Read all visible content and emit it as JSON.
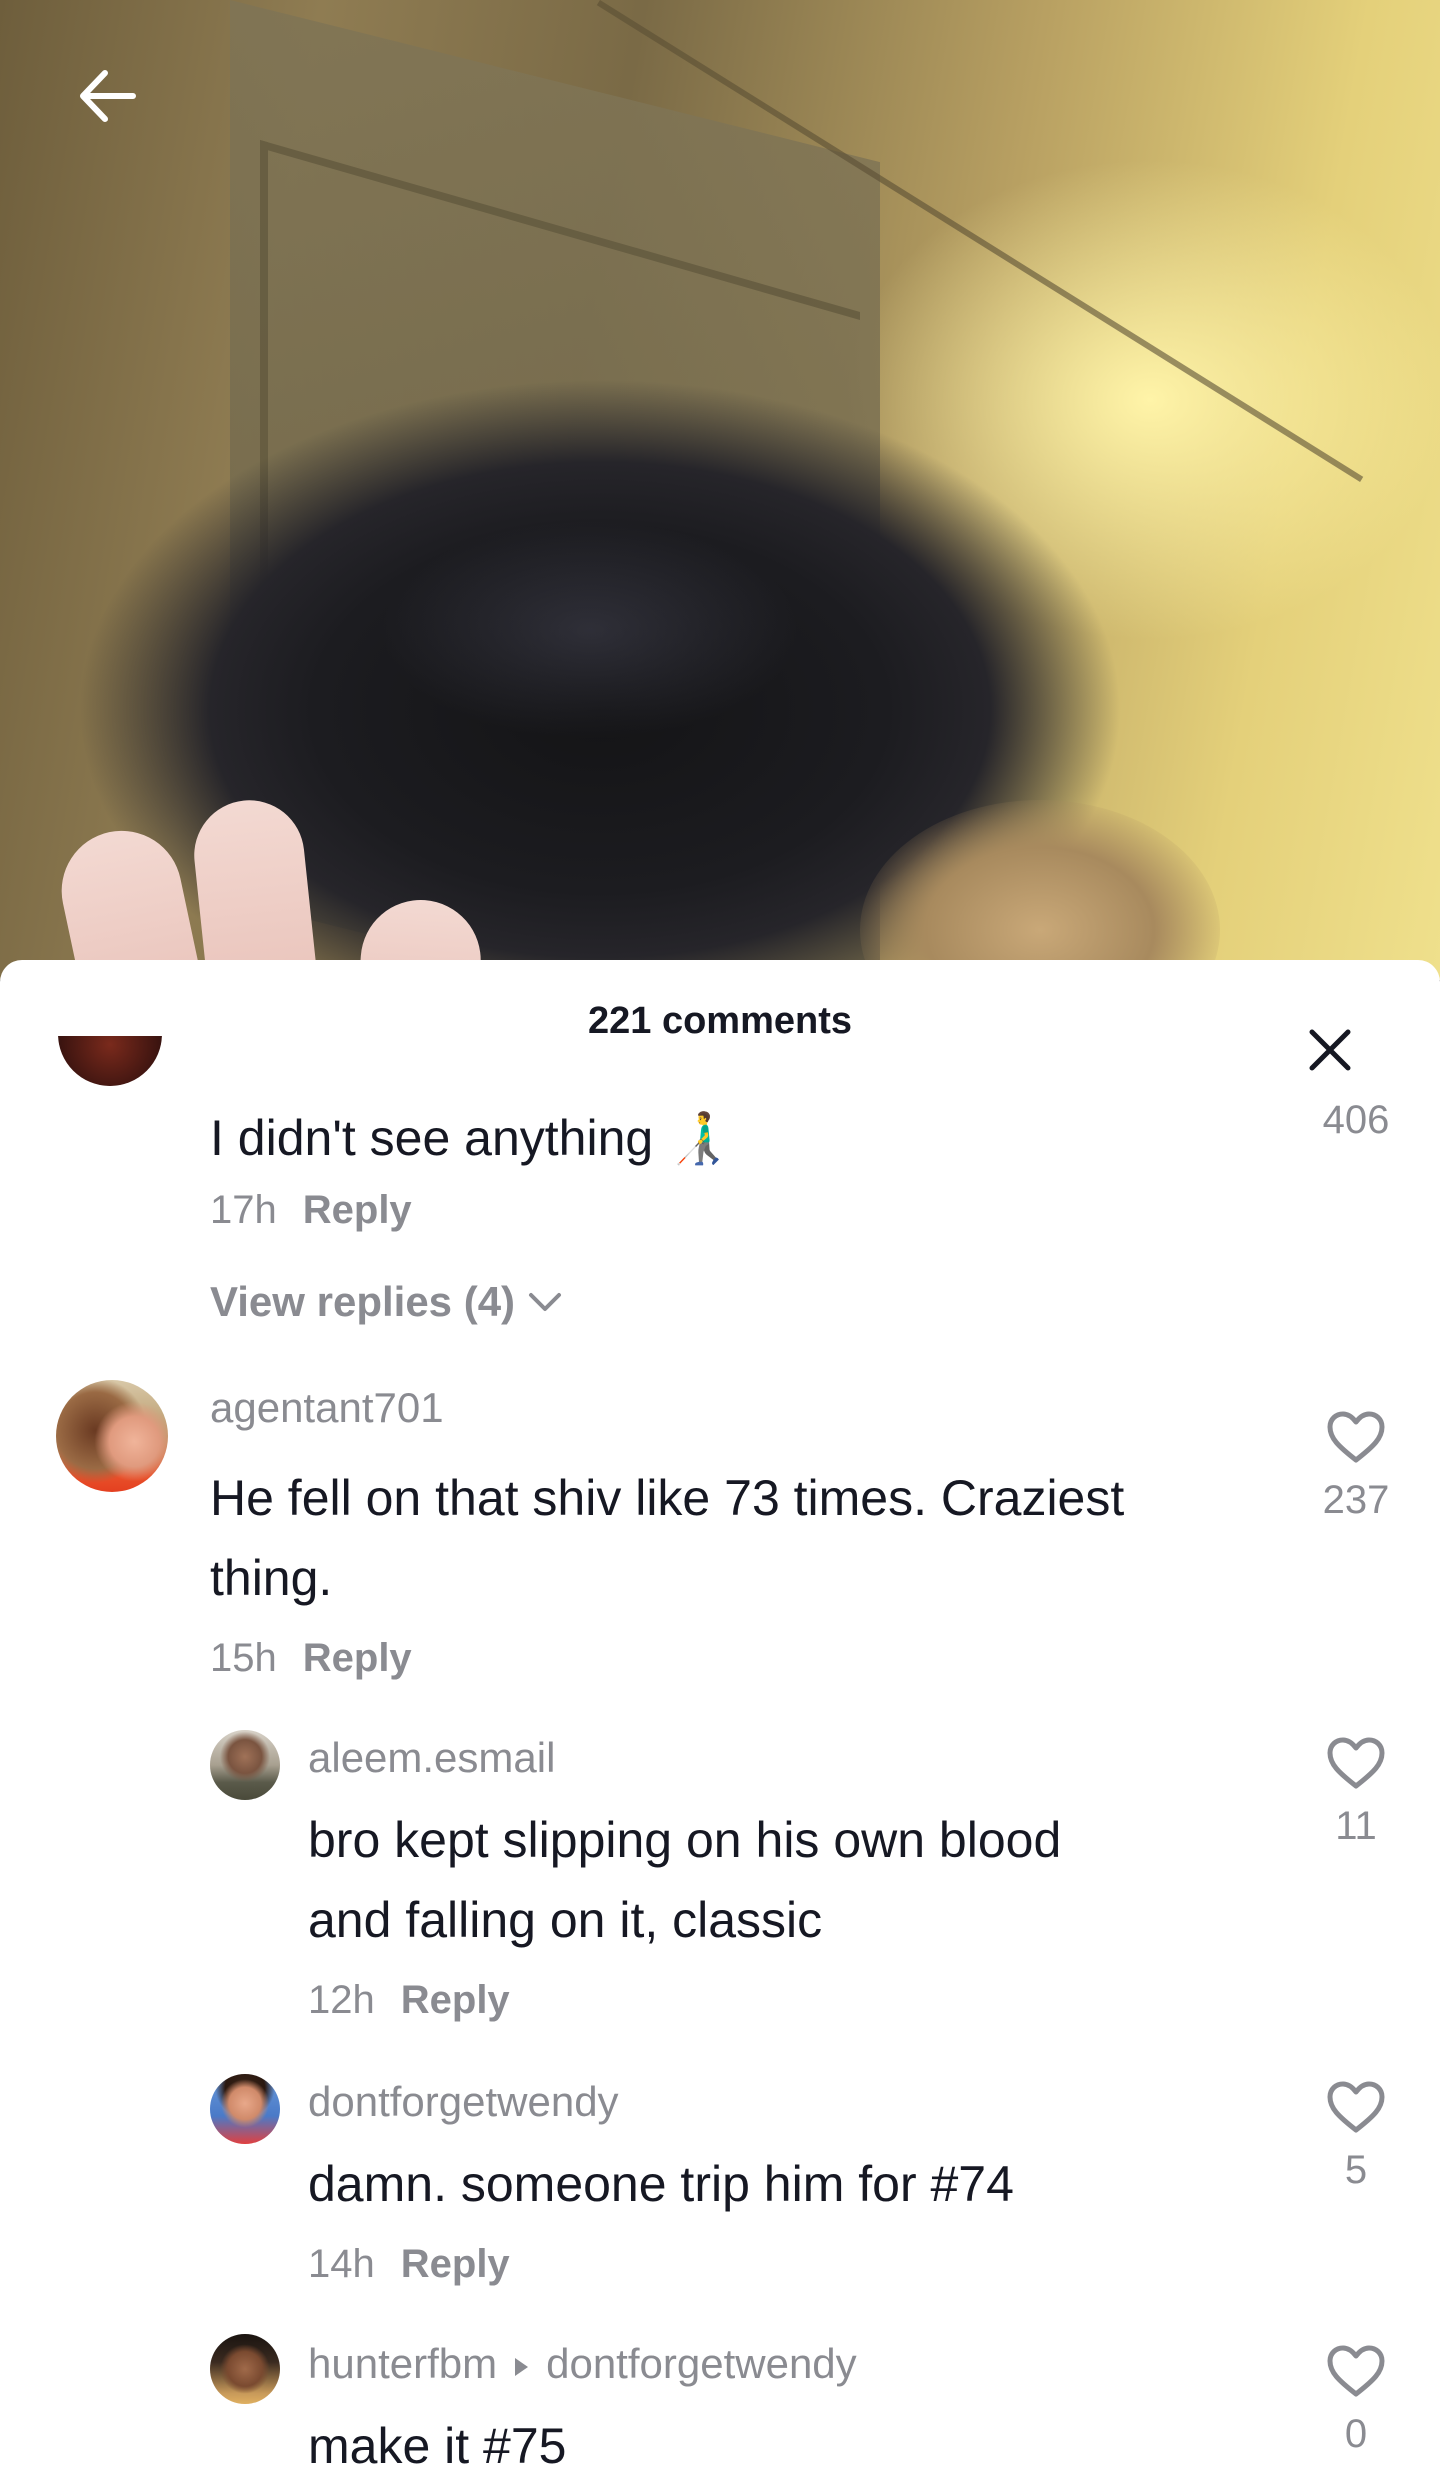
{
  "header": {
    "back_icon": "arrow-left-icon"
  },
  "sheet": {
    "title": "221 comments",
    "close_icon": "close-icon"
  },
  "comments": {
    "first": {
      "text": "I didn't see anything 👨‍🦯",
      "time": "17h",
      "reply_label": "Reply",
      "likes": "406",
      "view_replies": "View replies (4)"
    },
    "agentant": {
      "username": "agentant701",
      "text_line1": "He fell on that shiv like 73 times. Craziest",
      "text_line2": "thing.",
      "time": "15h",
      "reply_label": "Reply",
      "likes": "237"
    },
    "aleem": {
      "username": "aleem.esmail",
      "text_line1": "bro kept slipping on his own blood",
      "text_line2": "and falling on it, classic",
      "time": "12h",
      "reply_label": "Reply",
      "likes": "11"
    },
    "wendy": {
      "username": "dontforgetwendy",
      "text": "damn. someone trip him for #74",
      "time": "14h",
      "reply_label": "Reply",
      "likes": "5"
    },
    "hunter": {
      "username": "hunterfbm",
      "reply_to": "dontforgetwendy",
      "text": "make it #75",
      "likes": "0"
    }
  },
  "colors": {
    "text_primary": "#161823",
    "text_secondary": "#8a8b91",
    "sheet_bg": "#ffffff"
  }
}
